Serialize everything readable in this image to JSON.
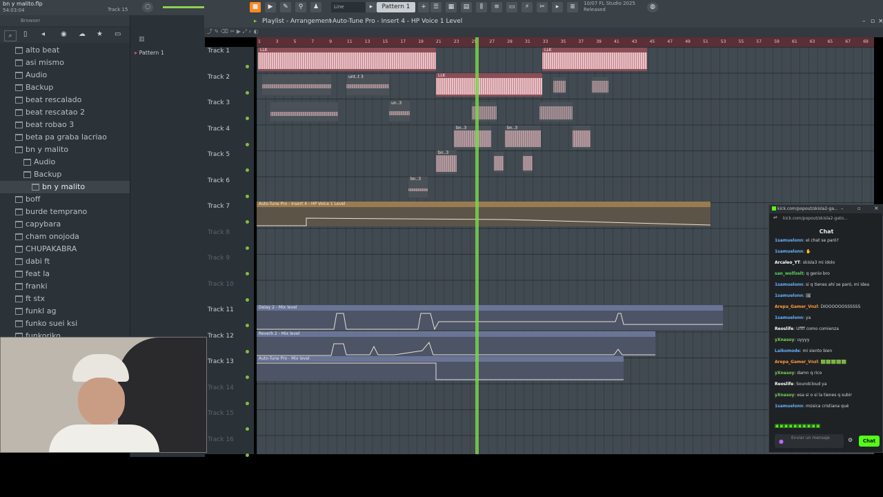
{
  "topbar": {
    "project": "bn y malito.flp",
    "time": "54:03:04",
    "track_hint": "Track 15",
    "snap": "Line",
    "pattern": "Pattern 1",
    "fl_version": "FL Studio 2025",
    "fl_status": "Released",
    "fl_date": "10/07"
  },
  "browser": {
    "title": "Browser",
    "items": [
      {
        "label": "alto beat",
        "indent": 1
      },
      {
        "label": "asi mismo",
        "indent": 1
      },
      {
        "label": "Audio",
        "indent": 1
      },
      {
        "label": "Backup",
        "indent": 1
      },
      {
        "label": "beat rescalado",
        "indent": 1
      },
      {
        "label": "beat rescatao 2",
        "indent": 1
      },
      {
        "label": "beat robao 3",
        "indent": 1
      },
      {
        "label": "beta pa graba lacriao",
        "indent": 1
      },
      {
        "label": "bn y malito",
        "indent": 1
      },
      {
        "label": "Audio",
        "indent": 2
      },
      {
        "label": "Backup",
        "indent": 2
      },
      {
        "label": "bn y malito",
        "indent": 3
      },
      {
        "label": "boff",
        "indent": 1
      },
      {
        "label": "burde temprano",
        "indent": 1
      },
      {
        "label": "capybara",
        "indent": 1
      },
      {
        "label": "cham onojoda",
        "indent": 1
      },
      {
        "label": "CHUPAKABRA",
        "indent": 1
      },
      {
        "label": "dabi ft",
        "indent": 1
      },
      {
        "label": "feat la",
        "indent": 1
      },
      {
        "label": "franki",
        "indent": 1
      },
      {
        "label": "ft stx",
        "indent": 1
      },
      {
        "label": "funkl ag",
        "indent": 1
      },
      {
        "label": "funko suei ksi",
        "indent": 1
      },
      {
        "label": "funkoriko",
        "indent": 1
      }
    ]
  },
  "pattern_panel": {
    "label": "Pattern 1"
  },
  "playlist": {
    "title": "Playlist - Arrangement",
    "path": "Auto-Tune Pro - Insert 4 - HP Voice 1 Level",
    "ruler": [
      "1",
      "3",
      "5",
      "7",
      "9",
      "11",
      "13",
      "15",
      "17",
      "19",
      "21",
      "23",
      "25",
      "27",
      "29",
      "31",
      "33",
      "35",
      "37",
      "39",
      "41",
      "43",
      "45",
      "47",
      "49",
      "51",
      "53",
      "55",
      "57",
      "59",
      "61",
      "63",
      "65",
      "67",
      "69"
    ],
    "tracks": [
      {
        "name": "Track 1",
        "dim": false
      },
      {
        "name": "Track 2",
        "dim": false
      },
      {
        "name": "Track 3",
        "dim": false
      },
      {
        "name": "Track 4",
        "dim": false
      },
      {
        "name": "Track 5",
        "dim": false
      },
      {
        "name": "Track 6",
        "dim": false
      },
      {
        "name": "Track 7",
        "dim": false
      },
      {
        "name": "Track 8",
        "dim": true
      },
      {
        "name": "Track 9",
        "dim": true
      },
      {
        "name": "Track 10",
        "dim": true
      },
      {
        "name": "Track 11",
        "dim": false
      },
      {
        "name": "Track 12",
        "dim": false
      },
      {
        "name": "Track 13",
        "dim": false
      },
      {
        "name": "Track 14",
        "dim": true
      },
      {
        "name": "Track 15",
        "dim": true
      },
      {
        "name": "Track 16",
        "dim": true
      }
    ],
    "auto_labels": {
      "t7": "Auto-Tune Pro - Insert 4 - HP Voice 1 Level",
      "t11": "Delay 2 - Mix level",
      "t12": "Reverb 2 - Mix level",
      "t13": "Auto-Tune Pro - Mix level"
    },
    "clip_labels": {
      "llk": "LLK",
      "unt": "unt..t 3",
      "un": "un..3",
      "bn": "bn..3"
    }
  },
  "chat": {
    "window_title": "kick.com/popout/skisla2-ga...",
    "url": "kick.com/popout/skisla2-gato...",
    "title": "Chat",
    "messages": [
      {
        "user": "1samuelonn",
        "text": "el chat se paró?",
        "color": "#66b3ff"
      },
      {
        "user": "1samuelonn",
        "text": "✋",
        "color": "#66b3ff"
      },
      {
        "user": "Arcaleo_YT",
        "text": "skisla3 mi idolo",
        "color": "#ffffff"
      },
      {
        "user": "san_wolfzelt",
        "text": "q genio bro",
        "color": "#5ed35e"
      },
      {
        "user": "1samuelonn",
        "text": "si q tienes ahí se paró, mi idea",
        "color": "#66b3ff"
      },
      {
        "user": "1samuelonn",
        "text": "🖼",
        "color": "#66b3ff"
      },
      {
        "user": "Arepa_Gamer_Vnzl",
        "text": "DIOOOOOOSSSSSS",
        "color": "#ff9a3c"
      },
      {
        "user": "1samuelonn",
        "text": "ya",
        "color": "#66b3ff"
      },
      {
        "user": "Reoslife",
        "text": "Uffff como comienza",
        "color": "#ffffff"
      },
      {
        "user": "yXnasoy",
        "text": "uyyyy",
        "color": "#7ad35a"
      },
      {
        "user": "Laikomode",
        "text": "mi siento bien",
        "color": "#66b3ff"
      },
      {
        "user": "Arepa_Gamer_Vnzl",
        "text": "🟩🟩🟩🟩🟩",
        "color": "#ff9a3c"
      },
      {
        "user": "yXnasoy",
        "text": "damn q rico",
        "color": "#7ad35a"
      },
      {
        "user": "Reoslife",
        "text": "Soundcloud ya",
        "color": "#ffffff"
      },
      {
        "user": "yXnasoy",
        "text": "esa si o si la tienes q subir",
        "color": "#7ad35a"
      },
      {
        "user": "1samuelonn",
        "text": "música cristiana qué",
        "color": "#66b3ff"
      }
    ],
    "input_placeholder": "Enviar un mensaje",
    "send_label": "Chat"
  }
}
